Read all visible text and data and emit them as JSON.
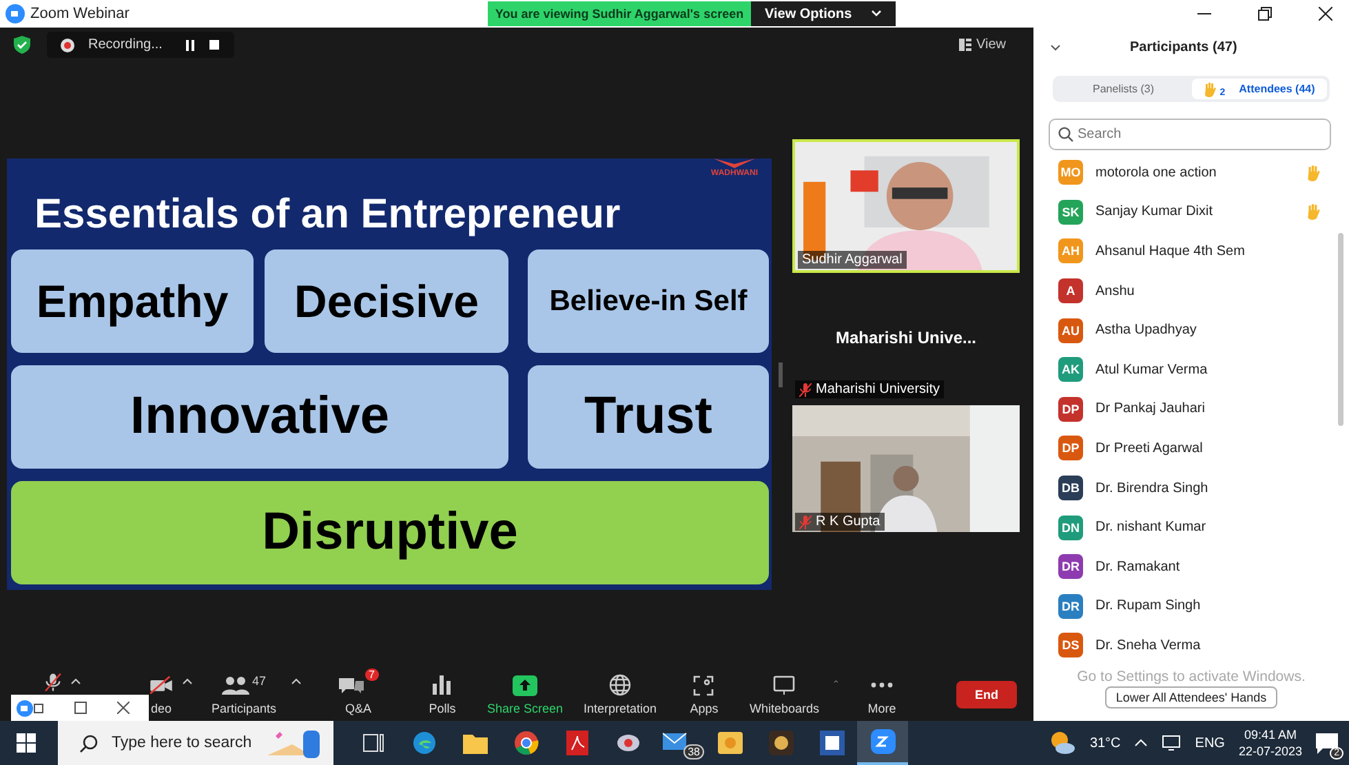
{
  "window": {
    "title": "Zoom Webinar"
  },
  "share_banner": {
    "text": "You are viewing Sudhir Aggarwal's screen",
    "button": "View Options"
  },
  "recording": {
    "label": "Recording..."
  },
  "view_button": "View",
  "slide": {
    "title": "Essentials of an Entrepreneur",
    "logo": "WADHWANI",
    "tiles": [
      {
        "label": "Empathy",
        "kind": "blue"
      },
      {
        "label": "Decisive",
        "kind": "blue"
      },
      {
        "label": "Believe-in Self",
        "kind": "blue"
      },
      {
        "label": "Innovative",
        "kind": "blue"
      },
      {
        "label": "Trust",
        "kind": "blue"
      },
      {
        "label": "Disruptive",
        "kind": "green"
      }
    ]
  },
  "videos": [
    {
      "kind": "picture",
      "name": "Sudhir Aggarwal",
      "active": true,
      "muted": false
    },
    {
      "kind": "name-only",
      "title": "Maharishi  Unive...",
      "name": "Maharishi University",
      "active": false,
      "muted": true
    },
    {
      "kind": "picture",
      "name": "R K Gupta",
      "active": false,
      "muted": true
    }
  ],
  "toolbar": [
    {
      "kind": "mic"
    },
    {
      "kind": "video",
      "label": "deo"
    },
    {
      "kind": "people",
      "label": "Participants",
      "count": "47"
    },
    {
      "kind": "qa",
      "label": "Q&A",
      "badge": "7"
    },
    {
      "kind": "polls",
      "label": "Polls"
    },
    {
      "kind": "share",
      "label": "Share Screen"
    },
    {
      "kind": "globe",
      "label": "Interpretation"
    },
    {
      "kind": "apps",
      "label": "Apps"
    },
    {
      "kind": "whiteboard",
      "label": "Whiteboards"
    },
    {
      "kind": "more",
      "label": "More"
    }
  ],
  "end_button": "End",
  "participants": {
    "title": "Participants (47)",
    "tabs": [
      {
        "label": "Panelists (3)",
        "selected": false
      },
      {
        "label": "Attendees (44)",
        "selected": true,
        "hands": "2"
      }
    ],
    "search": {
      "placeholder": "Search"
    },
    "people": [
      {
        "initials": "MO",
        "name": "motorola one action",
        "color": "#f0961c",
        "hand": true
      },
      {
        "initials": "SK",
        "name": "Sanjay Kumar Dixit",
        "color": "#23a45a",
        "hand": true
      },
      {
        "initials": "AH",
        "name": "Ahsanul Haque 4th Sem",
        "color": "#f0961c",
        "hand": false
      },
      {
        "initials": "A",
        "name": "Anshu",
        "color": "#c4322c",
        "hand": false
      },
      {
        "initials": "AU",
        "name": "Astha Upadhyay",
        "color": "#d9580f",
        "hand": false
      },
      {
        "initials": "AK",
        "name": "Atul Kumar Verma",
        "color": "#1f9c7c",
        "hand": false
      },
      {
        "initials": "DP",
        "name": "Dr Pankaj Jauhari",
        "color": "#c4322c",
        "hand": false
      },
      {
        "initials": "DP",
        "name": "Dr Preeti Agarwal",
        "color": "#d9580f",
        "hand": false
      },
      {
        "initials": "DB",
        "name": "Dr. Birendra Singh",
        "color": "#2a3e57",
        "hand": false
      },
      {
        "initials": "DN",
        "name": "Dr. nishant Kumar",
        "color": "#1f9c7c",
        "hand": false
      },
      {
        "initials": "DR",
        "name": "Dr. Ramakant",
        "color": "#8e3bb0",
        "hand": false
      },
      {
        "initials": "DR",
        "name": "Dr. Rupam Singh",
        "color": "#2a7fc0",
        "hand": false
      },
      {
        "initials": "DS",
        "name": "Dr. Sneha Verma",
        "color": "#d9580f",
        "hand": false
      }
    ],
    "activation_notice": "Go to Settings to activate Windows.",
    "lower_hands_button": "Lower All Attendees' Hands"
  },
  "taskbar": {
    "search_placeholder": "Type here to search",
    "mail_badge": "38",
    "weather": "31°C",
    "language": "ENG",
    "time": "09:41 AM",
    "date": "22-07-2023",
    "notifications": "2"
  }
}
